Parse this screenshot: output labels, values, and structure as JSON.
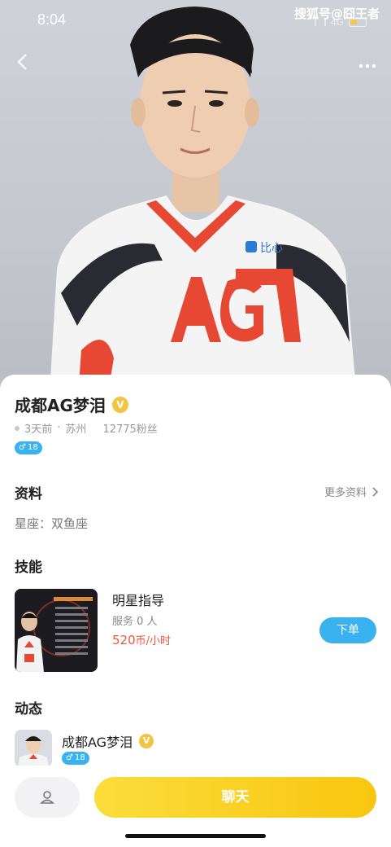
{
  "status_bar": {
    "time": "8:04",
    "network": "4G",
    "watermark": "搜狐号@囧王者"
  },
  "header": {
    "back_icon": "chevron-left-icon",
    "more_icon": "more-dots-icon"
  },
  "jersey": {
    "sponsor": "比心",
    "team_logo": "AG"
  },
  "profile": {
    "name": "成都AG梦泪",
    "verified_badge": "V",
    "last_active": "3天前",
    "location": "苏州",
    "fans": "12775粉丝",
    "gender_symbol": "♂",
    "age": "18"
  },
  "info_section": {
    "title": "资料",
    "more_label": "更多资料",
    "constellation": "星座：双鱼座"
  },
  "skills_section": {
    "title": "技能",
    "items": [
      {
        "name": "明星指导",
        "served": "服务 0 人",
        "price": "520",
        "unit": "币/小时",
        "order_label": "下单"
      }
    ]
  },
  "feed_section": {
    "title": "动态",
    "name": "成都AG梦泪",
    "gender_symbol": "♂",
    "age": "18"
  },
  "bottom_bar": {
    "follow_icon": "user-icon",
    "chat_label": "聊天"
  },
  "colors": {
    "accent_blue": "#3bb2f0",
    "chat_yellow": "#f8c60f",
    "price_red": "#f0553a",
    "verified_gold": "#f5c342"
  }
}
